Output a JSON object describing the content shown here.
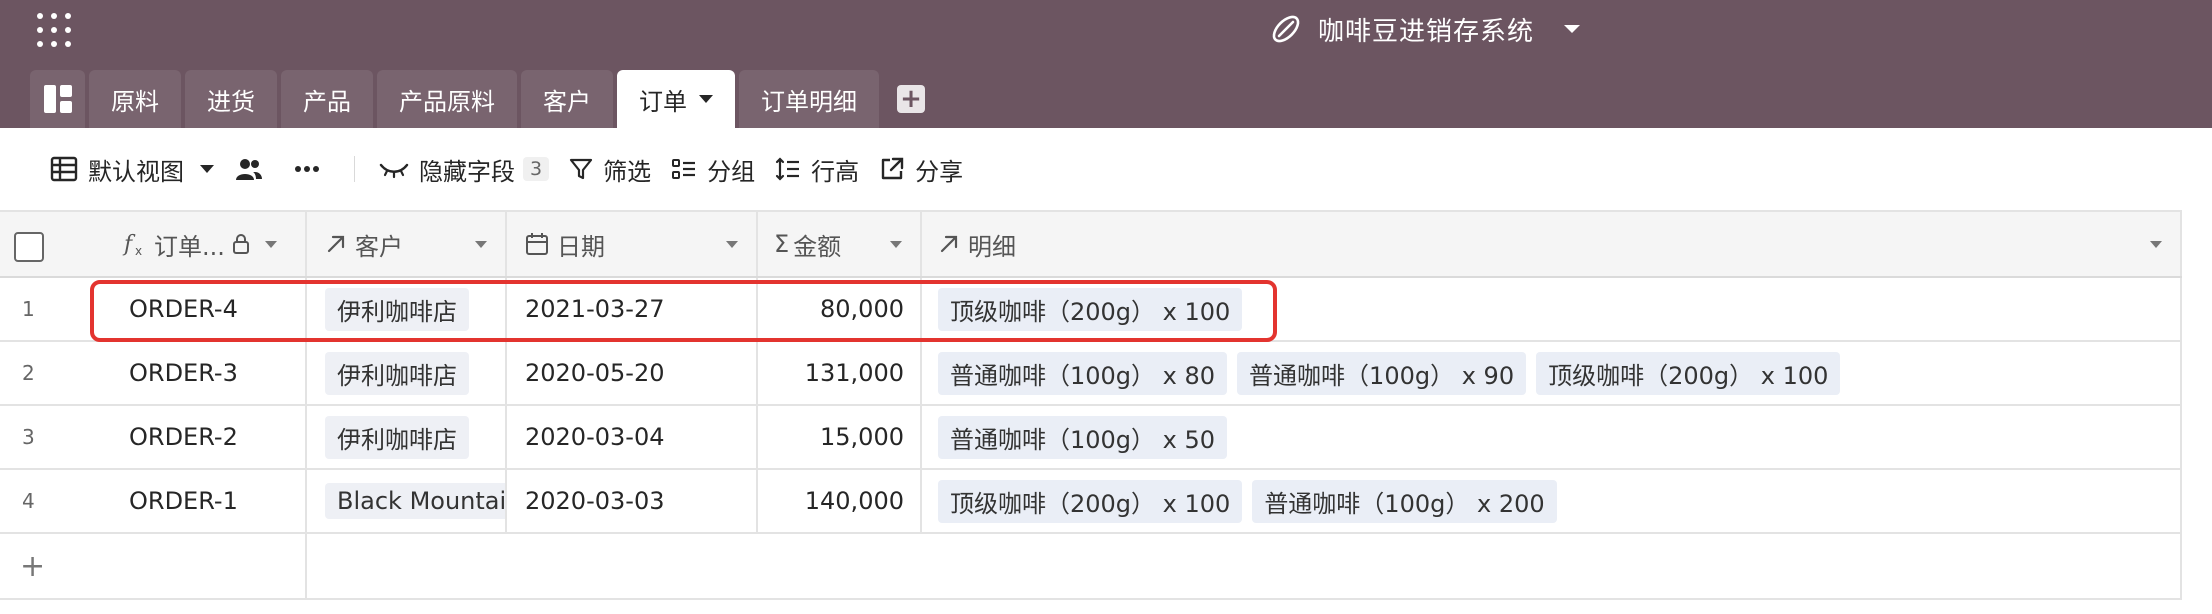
{
  "app": {
    "title": "咖啡豆进销存系统",
    "apps_icon": "grid-dots-icon",
    "title_icon": "coffee-bean-icon"
  },
  "tabs": [
    {
      "label": "原料",
      "active": false
    },
    {
      "label": "进货",
      "active": false
    },
    {
      "label": "产品",
      "active": false
    },
    {
      "label": "产品原料",
      "active": false
    },
    {
      "label": "客户",
      "active": false
    },
    {
      "label": "订单",
      "active": true
    },
    {
      "label": "订单明细",
      "active": false
    }
  ],
  "toolbar": {
    "view_label": "默认视图",
    "hidden_fields_label": "隐藏字段",
    "hidden_fields_count": "3",
    "filter_label": "筛选",
    "group_label": "分组",
    "row_height_label": "行高",
    "share_label": "分享"
  },
  "columns": {
    "order_no": "订单...",
    "customer": "客户",
    "date": "日期",
    "amount": "金额",
    "details": "明细"
  },
  "rows": [
    {
      "index": "1",
      "order": "ORDER-4",
      "customer": "伊利咖啡店",
      "date": "2021-03-27",
      "amount": "80,000",
      "details": [
        "顶级咖啡（200g） x 100"
      ],
      "highlighted": true
    },
    {
      "index": "2",
      "order": "ORDER-3",
      "customer": "伊利咖啡店",
      "date": "2020-05-20",
      "amount": "131,000",
      "details": [
        "普通咖啡（100g） x 80",
        "普通咖啡（100g） x 90",
        "顶级咖啡（200g） x 100"
      ]
    },
    {
      "index": "3",
      "order": "ORDER-2",
      "customer": "伊利咖啡店",
      "date": "2020-03-04",
      "amount": "15,000",
      "details": [
        "普通咖啡（100g） x 50"
      ]
    },
    {
      "index": "4",
      "order": "ORDER-1",
      "customer": "Black Mountai",
      "date": "2020-03-03",
      "amount": "140,000",
      "details": [
        "顶级咖啡（200g） x 100",
        "普通咖啡（100g） x 200"
      ]
    }
  ],
  "add_row_label": "+",
  "colors": {
    "header_bg": "#6c5561",
    "highlight": "#e3342f",
    "chip_bg": "#eaeef6"
  }
}
